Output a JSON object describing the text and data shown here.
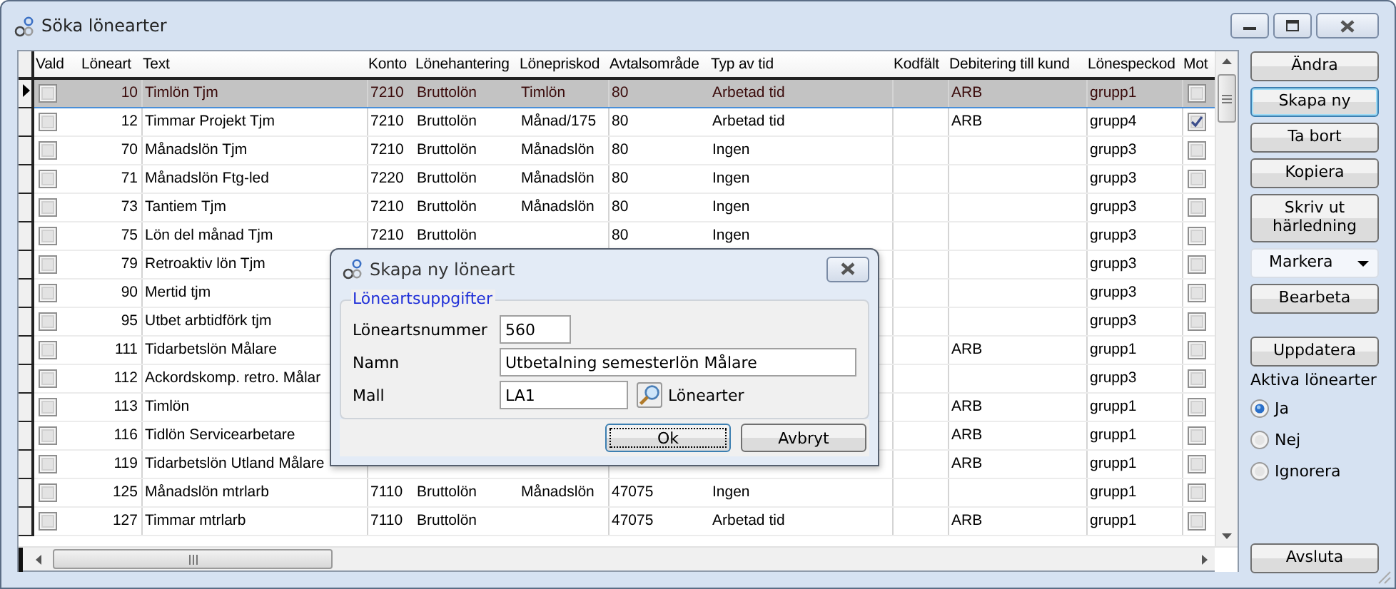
{
  "window": {
    "title": "Söka lönearter"
  },
  "table": {
    "columns": [
      "Vald",
      "Löneart",
      "Text",
      "Konto",
      "Lönehantering",
      "Lönepriskod",
      "Avtalsområde",
      "Typ av tid",
      "Kodfält",
      "Debitering till kund",
      "Lönespeckod",
      "Mot"
    ],
    "rows": [
      {
        "selected": true,
        "vald": false,
        "loneart": "10",
        "text": "Timlön Tjm",
        "konto": "7210",
        "hantering": "Bruttolön",
        "priskod": "Timlön",
        "avtal": "80",
        "typ": "Arbetad tid",
        "debitering": "ARB",
        "speckod": "grupp1",
        "mot": false
      },
      {
        "selected": false,
        "vald": false,
        "loneart": "12",
        "text": "Timmar Projekt Tjm",
        "konto": "7210",
        "hantering": "Bruttolön",
        "priskod": "Månad/175",
        "avtal": "80",
        "typ": "Arbetad tid",
        "debitering": "ARB",
        "speckod": "grupp4",
        "mot": true
      },
      {
        "selected": false,
        "vald": false,
        "loneart": "70",
        "text": "Månadslön Tjm",
        "konto": "7210",
        "hantering": "Bruttolön",
        "priskod": "Månadslön",
        "avtal": "80",
        "typ": "Ingen",
        "speckod": "grupp3",
        "mot": false
      },
      {
        "selected": false,
        "vald": false,
        "loneart": "71",
        "text": "Månadslön Ftg-led",
        "konto": "7220",
        "hantering": "Bruttolön",
        "priskod": "Månadslön",
        "avtal": "80",
        "typ": "Ingen",
        "speckod": "grupp3",
        "mot": false
      },
      {
        "selected": false,
        "vald": false,
        "loneart": "73",
        "text": "Tantiem Tjm",
        "konto": "7210",
        "hantering": "Bruttolön",
        "priskod": "Månadslön",
        "avtal": "80",
        "typ": "Ingen",
        "speckod": "grupp3",
        "mot": false
      },
      {
        "selected": false,
        "vald": false,
        "loneart": "75",
        "text": "Lön del månad Tjm",
        "konto": "7210",
        "hantering": "Bruttolön",
        "avtal": "80",
        "typ": "Ingen",
        "speckod": "grupp3",
        "mot": false
      },
      {
        "selected": false,
        "vald": false,
        "loneart": "79",
        "text": "Retroaktiv lön Tjm",
        "speckod": "grupp3",
        "mot": false
      },
      {
        "selected": false,
        "vald": false,
        "loneart": "90",
        "text": "Mertid tjm",
        "speckod": "grupp3",
        "mot": false
      },
      {
        "selected": false,
        "vald": false,
        "loneart": "95",
        "text": "Utbet arbtidförk tjm",
        "speckod": "grupp3",
        "mot": false
      },
      {
        "selected": false,
        "vald": false,
        "loneart": "111",
        "text": "Tidarbetslön Målare",
        "debitering": "ARB",
        "speckod": "grupp1",
        "mot": false
      },
      {
        "selected": false,
        "vald": false,
        "loneart": "112",
        "text": "Ackordskomp. retro. Målar",
        "speckod": "grupp3",
        "mot": false
      },
      {
        "selected": false,
        "vald": false,
        "loneart": "113",
        "text": "Timlön",
        "debitering": "ARB",
        "speckod": "grupp1",
        "mot": false
      },
      {
        "selected": false,
        "vald": false,
        "loneart": "116",
        "text": "Tidlön Servicearbetare",
        "debitering": "ARB",
        "speckod": "grupp1",
        "mot": false
      },
      {
        "selected": false,
        "vald": false,
        "loneart": "119",
        "text": "Tidarbetslön Utland Målare",
        "debitering": "ARB",
        "speckod": "grupp1",
        "mot": false
      },
      {
        "selected": false,
        "vald": false,
        "loneart": "125",
        "text": "Månadslön mtrlarb",
        "konto": "7110",
        "hantering": "Bruttolön",
        "priskod": "Månadslön",
        "avtal": "47075",
        "typ": "Ingen",
        "speckod": "grupp1",
        "mot": false
      },
      {
        "selected": false,
        "vald": false,
        "loneart": "127",
        "text": "Timmar mtrlarb",
        "konto": "7110",
        "hantering": "Bruttolön",
        "avtal": "47075",
        "typ": "Arbetad tid",
        "debitering": "ARB",
        "speckod": "grupp1",
        "mot": false
      }
    ]
  },
  "side_panel": {
    "buttons": [
      {
        "label": "Ändra",
        "kind": "button",
        "focused": false
      },
      {
        "label": "Skapa ny",
        "kind": "button",
        "focused": true
      },
      {
        "label": "Ta bort",
        "kind": "button",
        "focused": false
      },
      {
        "label": "Kopiera",
        "kind": "button",
        "focused": false
      },
      {
        "label": "Skriv ut härledning",
        "kind": "button",
        "focused": false
      },
      {
        "label": "Markera",
        "kind": "menu",
        "focused": false
      },
      {
        "label": "Bearbeta",
        "kind": "button",
        "focused": false
      },
      {
        "label": "Uppdatera",
        "kind": "button",
        "focused": false
      }
    ],
    "filter_label": "Aktiva lönearter",
    "radios": [
      {
        "label": "Ja",
        "selected": true
      },
      {
        "label": "Nej",
        "selected": false
      },
      {
        "label": "Ignorera",
        "selected": false
      }
    ],
    "close_button": "Avsluta"
  },
  "dialog": {
    "title": "Skapa ny löneart",
    "group": "Löneartsuppgifter",
    "fields": [
      {
        "label": "Löneartsnummer",
        "value": "560",
        "kind": "short"
      },
      {
        "label": "Namn",
        "value": "Utbetalning semesterlön Målare",
        "kind": "wide"
      },
      {
        "label": "Mall",
        "value": "LA1",
        "kind": "lookup",
        "lookup_label": "Lönearter"
      }
    ],
    "buttons": [
      {
        "label": "Ok",
        "focused": true
      },
      {
        "label": "Avbryt",
        "focused": false
      }
    ]
  }
}
